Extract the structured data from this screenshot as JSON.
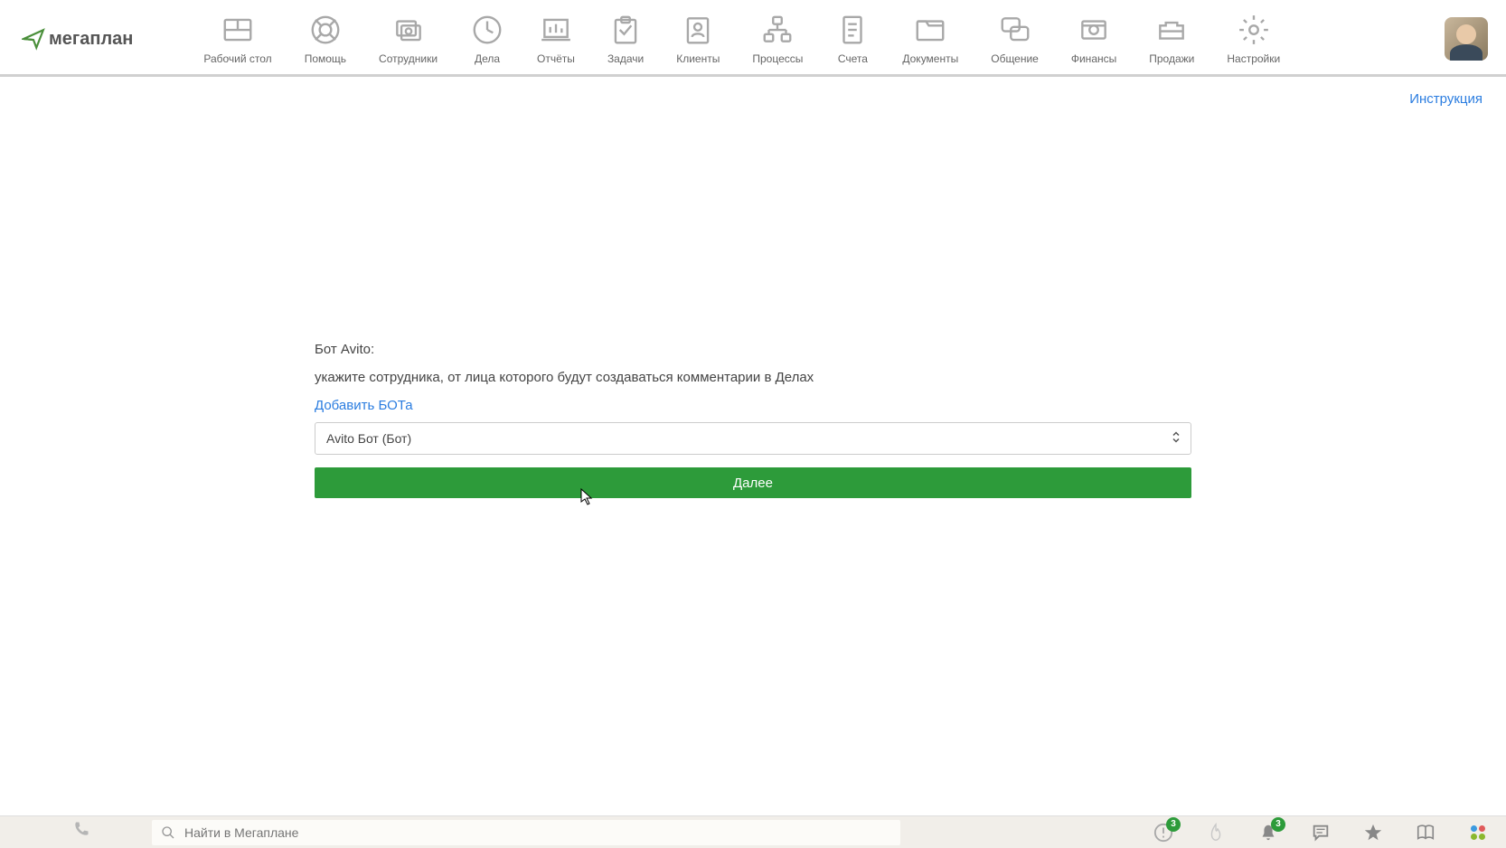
{
  "brand": "мегаплан",
  "nav": {
    "items": [
      {
        "label": "Рабочий стол",
        "icon": "dashboard-icon"
      },
      {
        "label": "Помощь",
        "icon": "help-icon"
      },
      {
        "label": "Сотрудники",
        "icon": "employees-icon"
      },
      {
        "label": "Дела",
        "icon": "deals-icon"
      },
      {
        "label": "Отчёты",
        "icon": "reports-icon"
      },
      {
        "label": "Задачи",
        "icon": "tasks-icon"
      },
      {
        "label": "Клиенты",
        "icon": "clients-icon"
      },
      {
        "label": "Процессы",
        "icon": "processes-icon"
      },
      {
        "label": "Счета",
        "icon": "invoices-icon"
      },
      {
        "label": "Документы",
        "icon": "documents-icon"
      },
      {
        "label": "Общение",
        "icon": "chat-icon"
      },
      {
        "label": "Финансы",
        "icon": "finance-icon"
      },
      {
        "label": "Продажи",
        "icon": "sales-icon"
      },
      {
        "label": "Настройки",
        "icon": "settings-icon"
      }
    ]
  },
  "sublink": {
    "label": "Инструкция"
  },
  "form": {
    "title": "Бот Avito:",
    "subtitle": "укажите сотрудника, от лица которого будут создаваться комментарии в Делах",
    "add_bot_label": "Добавить БОТа",
    "select_value": "Avito Бот (Бот)",
    "next_label": "Далее"
  },
  "bottombar": {
    "search_placeholder": "Найти в Мегаплане",
    "badge_notifications": "3",
    "badge_bell": "3"
  }
}
